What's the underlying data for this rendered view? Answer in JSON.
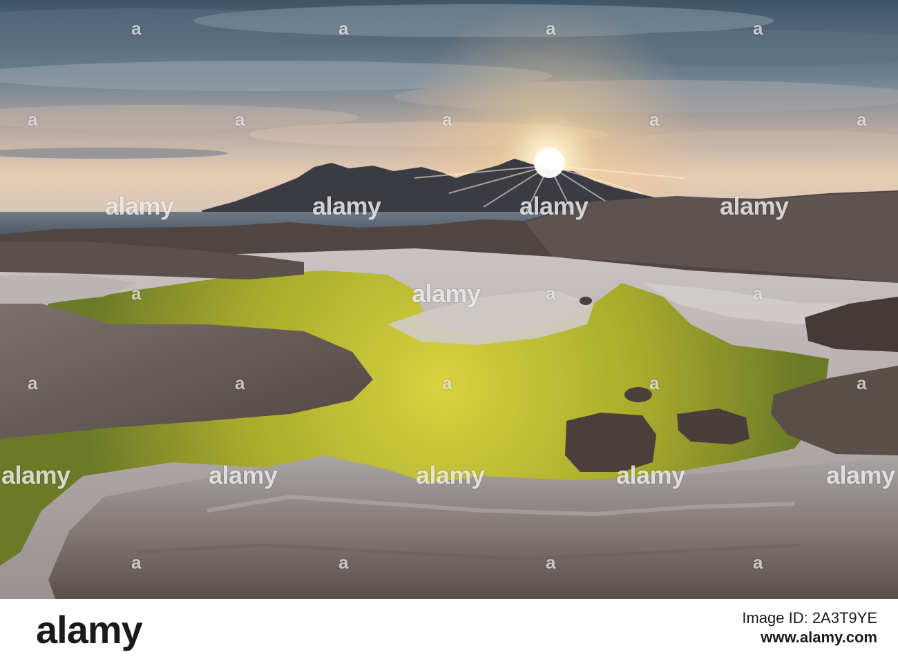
{
  "watermark": {
    "wordmark": "alamy",
    "letter": "a"
  },
  "footer": {
    "logo": "alamy",
    "image_id_line": "Image ID: 2A3T9YE",
    "url": "www.alamy.com"
  },
  "colors": {
    "sky_top": "#4c6478",
    "sun": "#fff4d6",
    "algae": "#c4c23a",
    "rock": "#6f6660"
  }
}
